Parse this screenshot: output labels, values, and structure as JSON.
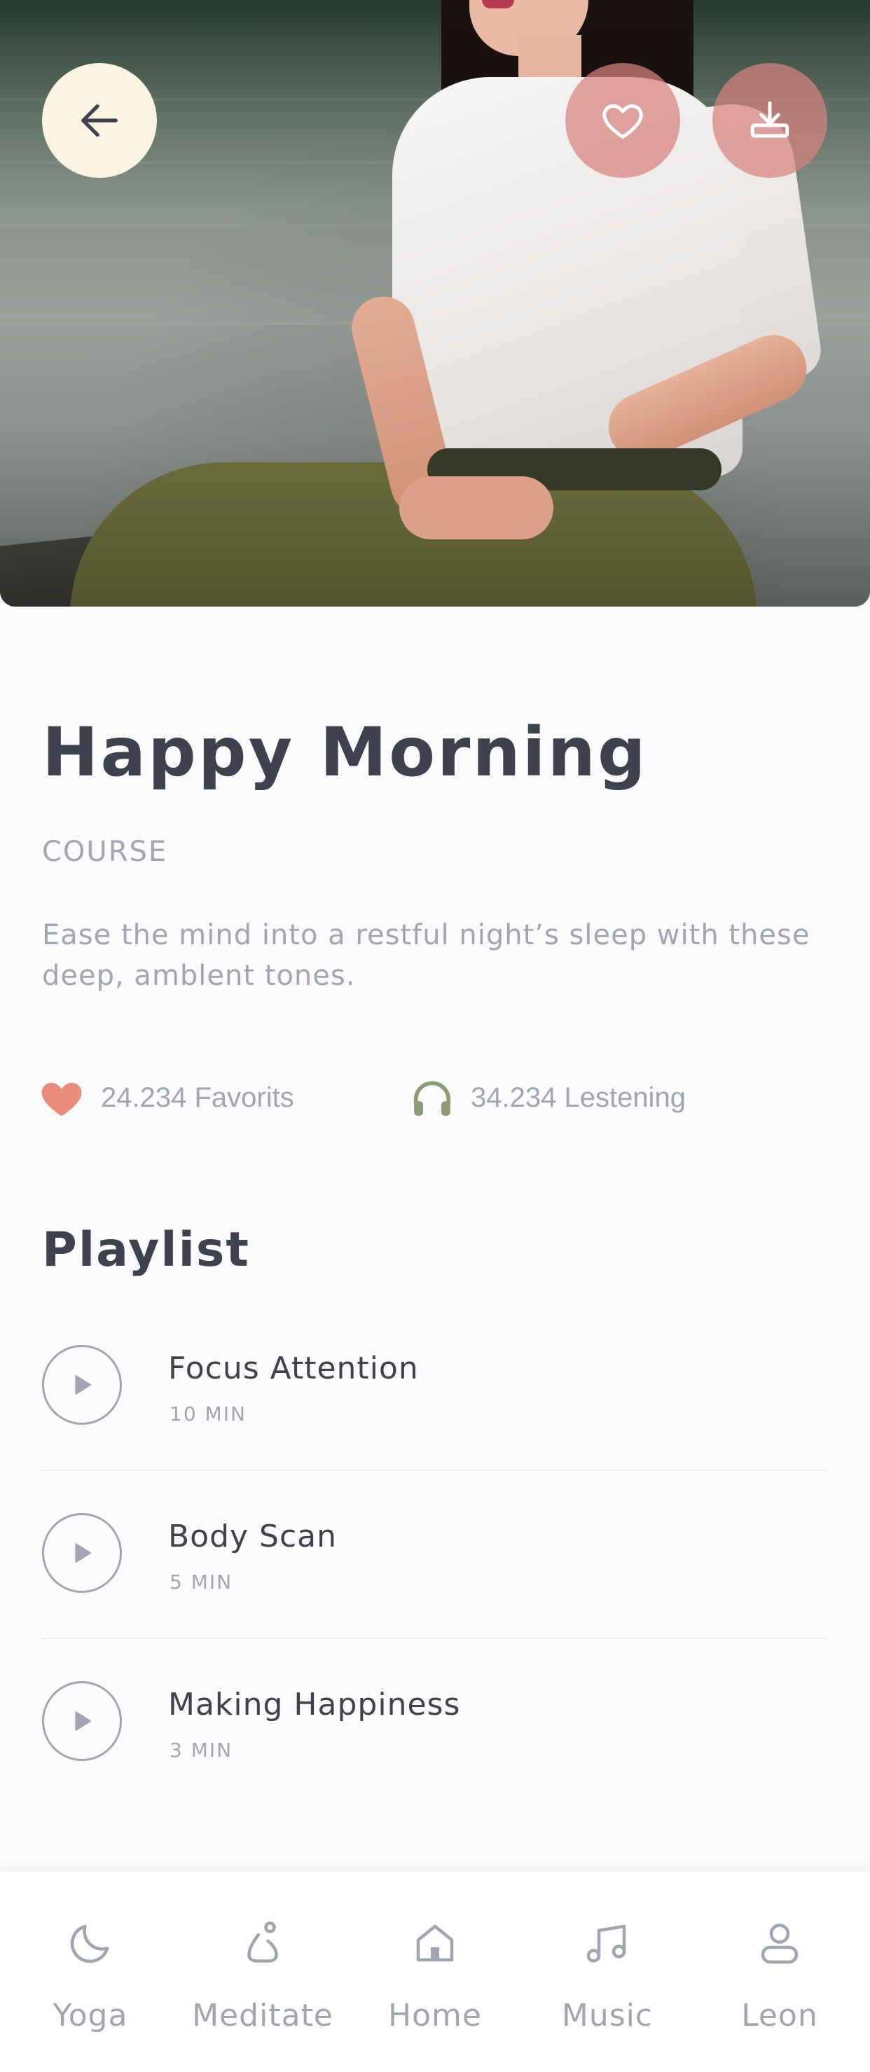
{
  "header": {
    "back_icon": "arrow-left-icon",
    "favorite_icon": "heart-outline-icon",
    "download_icon": "download-icon"
  },
  "course": {
    "title": "Happy Morning",
    "type": "COURSE",
    "description": "Ease the mind into a restful night’s sleep  with these deep, amblent tones."
  },
  "stats": {
    "favorites": "24.234 Favorits",
    "listening": "34.234 Lestening"
  },
  "playlist": {
    "title": "Playlist",
    "items": [
      {
        "name": "Focus Attention",
        "duration": "10 MIN"
      },
      {
        "name": "Body Scan",
        "duration": "5 MIN"
      },
      {
        "name": "Making Happiness",
        "duration": "3 MIN"
      }
    ]
  },
  "tabbar": {
    "items": [
      {
        "label": "Yoga",
        "icon": "moon-icon"
      },
      {
        "label": "Meditate",
        "icon": "meditate-icon"
      },
      {
        "label": "Home",
        "icon": "home-icon"
      },
      {
        "label": "Music",
        "icon": "music-note-icon"
      },
      {
        "label": "Leon",
        "icon": "profile-icon"
      }
    ]
  },
  "colors": {
    "primary_text": "#3f414e",
    "secondary_text": "#a1a4b2",
    "accent_heart": "#e98b7b",
    "accent_headphones": "#8e9b76",
    "back_button_bg": "#faf3e0",
    "hero_button_bg": "#d7827d"
  }
}
